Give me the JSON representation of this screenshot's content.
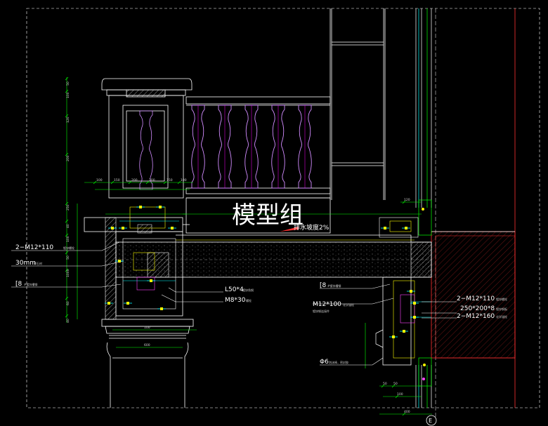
{
  "watermark": "模型组",
  "slope_note": "排水坡度2%",
  "grid_axis_label": "E",
  "left_callouts": [
    {
      "main": "2−M12*110",
      "sub": "镀锌螺栓"
    },
    {
      "main": "30mm",
      "sub": "厚石材"
    },
    {
      "main": "[8",
      "sub": "#镀锌槽钢"
    }
  ],
  "center_callouts": [
    {
      "main": "L50*4",
      "sub": "镀锌角钢"
    },
    {
      "main": "M8*30",
      "sub": "螺栓"
    }
  ],
  "right_callouts": [
    {
      "main": "[8",
      "sub": "#镀锌槽钢"
    },
    {
      "main": "M12*100",
      "sub": "化学锚栓"
    },
    {
      "main": "",
      "sub": "镀锌钢连接件"
    },
    {
      "main": "2−M12*110",
      "sub": "镀锌螺栓"
    },
    {
      "main": "250*200*8",
      "sub": "镀锌钢板"
    },
    {
      "main": "2−M12*160",
      "sub": "化学锚栓"
    }
  ],
  "bottom_callout": {
    "main": "Φ6",
    "sub": "泡沫棒，密封胶"
  },
  "dims": {
    "left_vertical": [
      "50",
      "100",
      "120",
      "200",
      "250",
      "40",
      "100",
      "50",
      "1000",
      "60",
      "40"
    ],
    "top_horizontal": [
      "100",
      "150",
      "200",
      "200",
      "150",
      "100"
    ],
    "bottom_horizontal": [
      "100",
      "600"
    ],
    "right_horizontal": [
      "120",
      "50",
      "50",
      "100",
      "400"
    ]
  },
  "colors": {
    "background": "#000000",
    "outline": "#ffffff",
    "dimension": "#00ff00",
    "accent": "#ffff00",
    "baluster": "#d28cff",
    "leader": "#00ffff",
    "wall_hatch": "#ff3030"
  }
}
